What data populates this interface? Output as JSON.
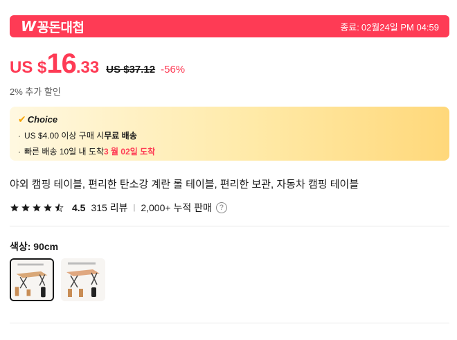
{
  "promo": {
    "logo_mark": "W",
    "logo_text": "꽁돈대첩",
    "end_label": "종료:",
    "end_time": "02월24일 PM 04:59"
  },
  "price": {
    "currency": "US $",
    "integer": "16",
    "decimal": ".33",
    "original": "US $37.12",
    "discount": "-56%"
  },
  "extra_discount": "2% 추가 할인",
  "choice": {
    "title": "Choice",
    "line1_prefix": "US $4.00 이상 구매 시 ",
    "line1_bold": "무료 배송",
    "line2_prefix": "빠른 배송 10일 내 도착 ",
    "line2_red": "3 월 02일 도착"
  },
  "product_title": "야외 캠핑 테이블, 편리한 탄소강 계란 롤 테이블, 편리한 보관, 자동차 캠핑 테이블",
  "rating": {
    "value": "4.5",
    "reviews": "315 리뷰",
    "sold": "2,000+ 누적 판매",
    "star_color": "#191919"
  },
  "color_selector": {
    "label": "색상: 90cm",
    "selected_index": 0
  },
  "colors": {
    "accent": "#fe3b55",
    "choice_gold": "#ffd87a"
  }
}
